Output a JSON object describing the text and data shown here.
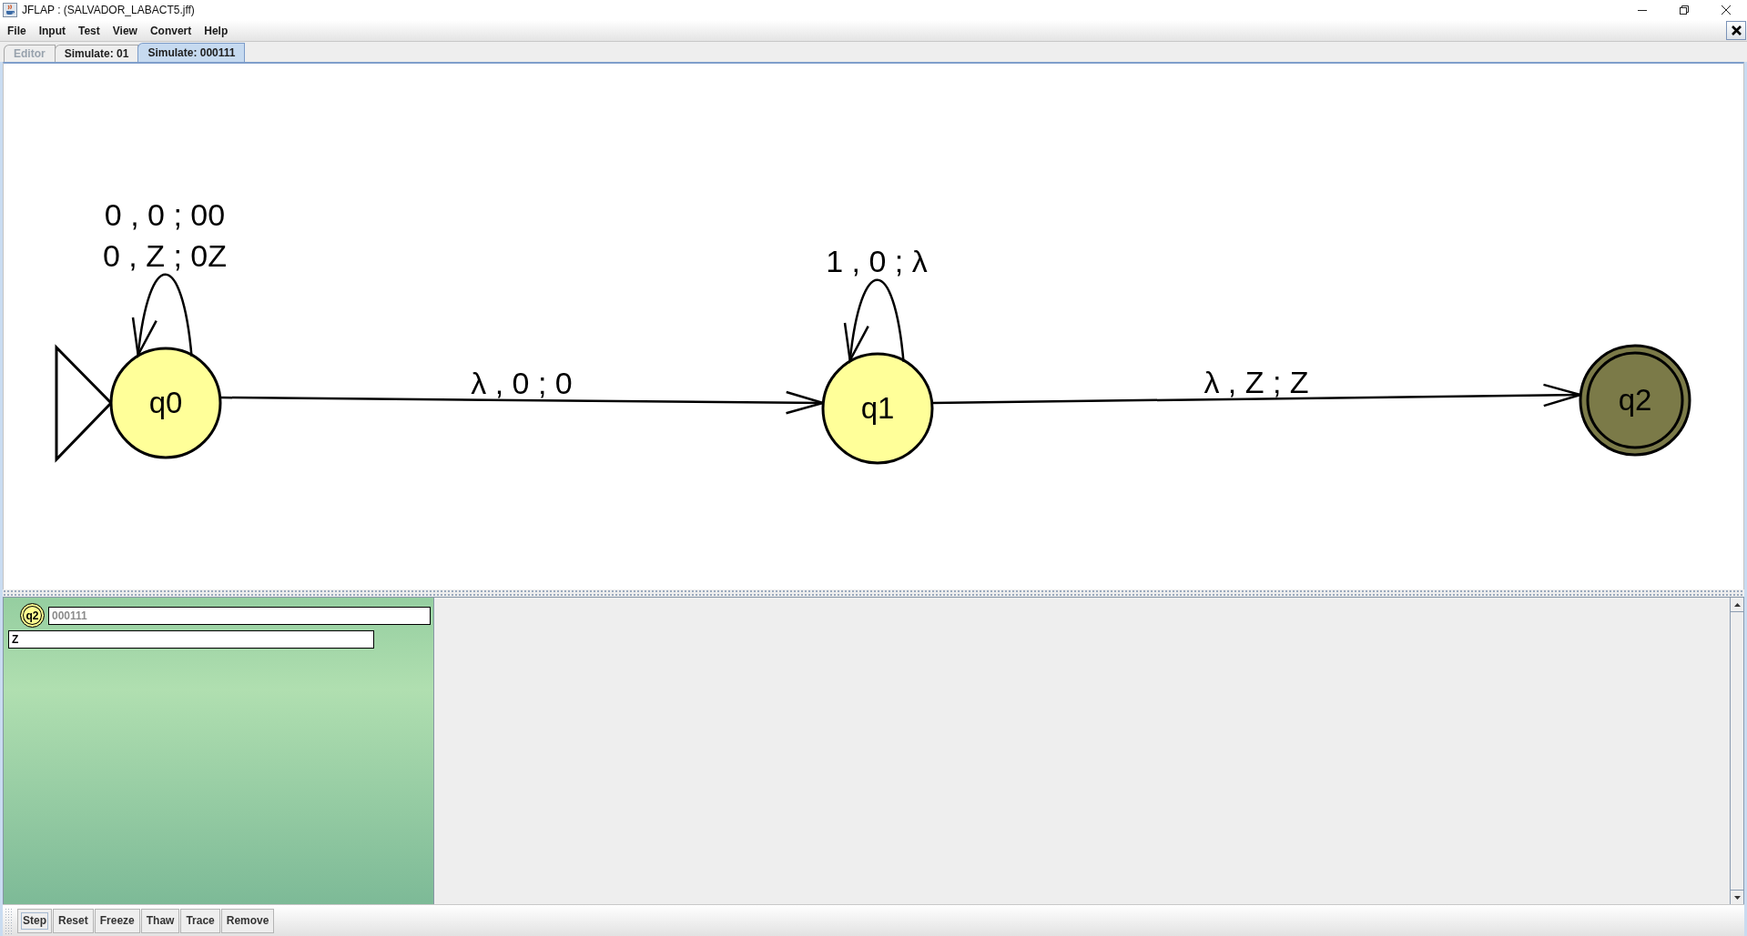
{
  "window": {
    "title": "JFLAP : (SALVADOR_LABACT5.jff)"
  },
  "menu": [
    "File",
    "Input",
    "Test",
    "View",
    "Convert",
    "Help"
  ],
  "tabs": [
    {
      "label": "Editor",
      "selected": false,
      "disabled": true
    },
    {
      "label": "Simulate: 01",
      "selected": false,
      "disabled": false
    },
    {
      "label": "Simulate: 000111",
      "selected": true,
      "disabled": false
    }
  ],
  "automaton": {
    "states": [
      {
        "name": "q0",
        "initial": true,
        "final": false,
        "highlighted": false,
        "loop_labels": [
          "0 , 0 ; 00",
          "0 , Z ; 0Z"
        ]
      },
      {
        "name": "q1",
        "initial": false,
        "final": false,
        "highlighted": false,
        "loop_labels": [
          "1 , 0 ; λ"
        ]
      },
      {
        "name": "q2",
        "initial": false,
        "final": true,
        "highlighted": true
      }
    ],
    "edges": [
      {
        "label": "λ , 0 ; 0"
      },
      {
        "label": "λ , Z ; Z"
      }
    ]
  },
  "configuration": {
    "state": "q2",
    "final": true,
    "input": "000111",
    "input_consumed": true,
    "stack": "Z",
    "accepted": true
  },
  "buttons": [
    {
      "label": "Step",
      "focused": true
    },
    {
      "label": "Reset",
      "focused": false
    },
    {
      "label": "Freeze",
      "focused": false
    },
    {
      "label": "Thaw",
      "focused": false
    },
    {
      "label": "Trace",
      "focused": false
    },
    {
      "label": "Remove",
      "focused": false
    }
  ]
}
